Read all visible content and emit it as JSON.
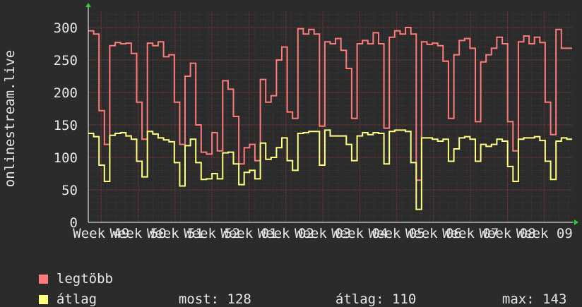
{
  "chart_data": {
    "type": "line",
    "ylabel": "onlinestream.live",
    "ylim": [
      0,
      325
    ],
    "y_ticks": [
      0,
      50,
      100,
      150,
      200,
      250,
      300
    ],
    "x_ticks": [
      "Week 49",
      "Week 50",
      "Week 51",
      "Week 52",
      "Week 01",
      "Week 02",
      "Week 03",
      "Week 04",
      "Week 05",
      "Week 06",
      "Week 07",
      "Week 08",
      "Week 09"
    ],
    "grid": true,
    "series": [
      {
        "name": "legtöbb",
        "color": "#ff7b7b",
        "values": [
          295,
          290,
          172,
          120,
          272,
          277,
          275,
          276,
          260,
          185,
          128,
          276,
          272,
          278,
          255,
          258,
          185,
          120,
          225,
          245,
          150,
          108,
          105,
          138,
          110,
          218,
          205,
          163,
          90,
          115,
          120,
          95,
          220,
          185,
          195,
          250,
          270,
          170,
          160,
          298,
          290,
          297,
          290,
          148,
          278,
          275,
          283,
          265,
          237,
          160,
          275,
          280,
          275,
          292,
          275,
          145,
          285,
          295,
          290,
          300,
          290,
          65,
          278,
          274,
          276,
          272,
          248,
          160,
          258,
          280,
          283,
          268,
          155,
          247,
          258,
          268,
          285,
          275,
          155,
          110,
          278,
          287,
          275,
          285,
          277,
          185,
          135,
          297,
          268,
          268
        ],
        "stats": []
      },
      {
        "name": "átlag",
        "color": "#ffff80",
        "values": [
          137,
          132,
          88,
          63,
          134,
          137,
          138,
          133,
          128,
          94,
          70,
          140,
          136,
          130,
          127,
          124,
          92,
          56,
          118,
          128,
          92,
          66,
          67,
          75,
          67,
          107,
          108,
          90,
          58,
          77,
          80,
          67,
          122,
          97,
          100,
          115,
          130,
          95,
          80,
          137,
          138,
          140,
          140,
          88,
          142,
          133,
          133,
          133,
          120,
          95,
          133,
          138,
          135,
          138,
          137,
          90,
          140,
          142,
          142,
          140,
          92,
          20,
          130,
          130,
          128,
          125,
          128,
          94,
          113,
          130,
          132,
          128,
          94,
          120,
          117,
          120,
          128,
          125,
          86,
          63,
          128,
          130,
          130,
          132,
          126,
          94,
          66,
          125,
          130,
          128
        ],
        "stats": [
          {
            "label": "most:",
            "value": "128"
          },
          {
            "label": "átlag:",
            "value": "110"
          },
          {
            "label": "max:",
            "value": "143"
          }
        ]
      }
    ]
  }
}
